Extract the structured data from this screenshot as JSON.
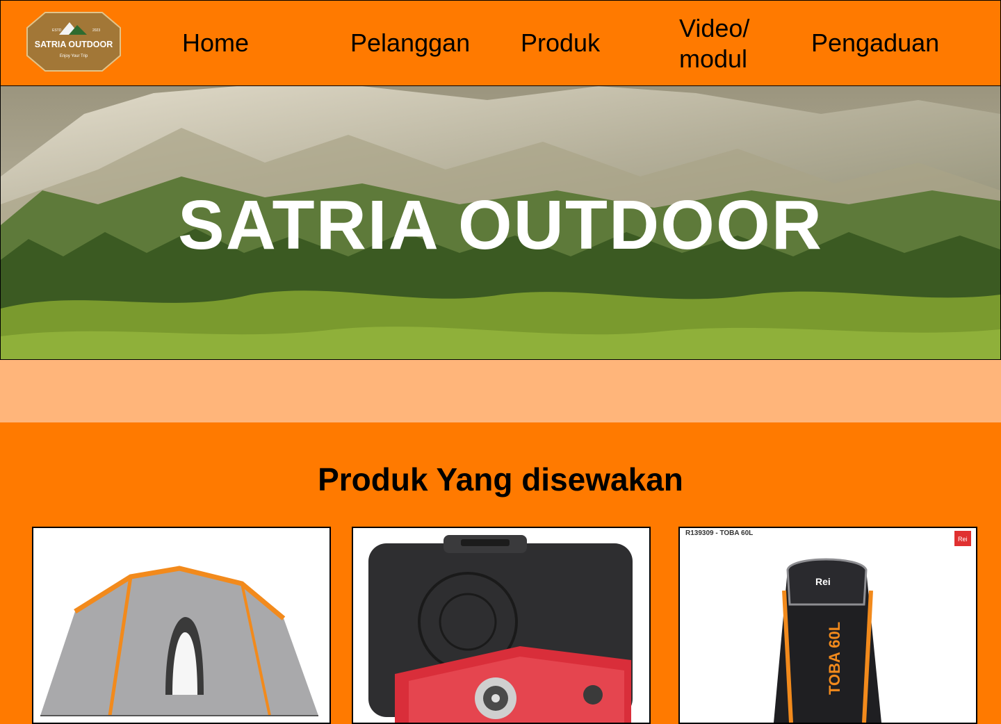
{
  "header": {
    "logo": {
      "name": "SATRIA OUTDOOR",
      "tagline": "Enjoy Your Trip",
      "estd": "ESTD",
      "year": "2023"
    },
    "nav": {
      "home": "Home",
      "pelanggan": "Pelanggan",
      "produk": "Produk",
      "video_line1": "Video/",
      "video_line2": "modul",
      "pengaduan": "Pengaduan"
    }
  },
  "hero": {
    "title": "SATRIA OUTDOOR"
  },
  "products": {
    "title": "Produk Yang disewakan",
    "items": [
      {
        "image": "tent-image"
      },
      {
        "image": "portable-gas-stove-image"
      },
      {
        "image": "backpack-image",
        "code": "R139309 - TOBA 60L",
        "print": "TOBA 60L",
        "brand": "Rei"
      }
    ]
  },
  "colors": {
    "primary": "#ff7a00",
    "band": "#ffb57a",
    "text": "#000000",
    "hero_text": "#ffffff",
    "logo_bg": "#a27737"
  }
}
